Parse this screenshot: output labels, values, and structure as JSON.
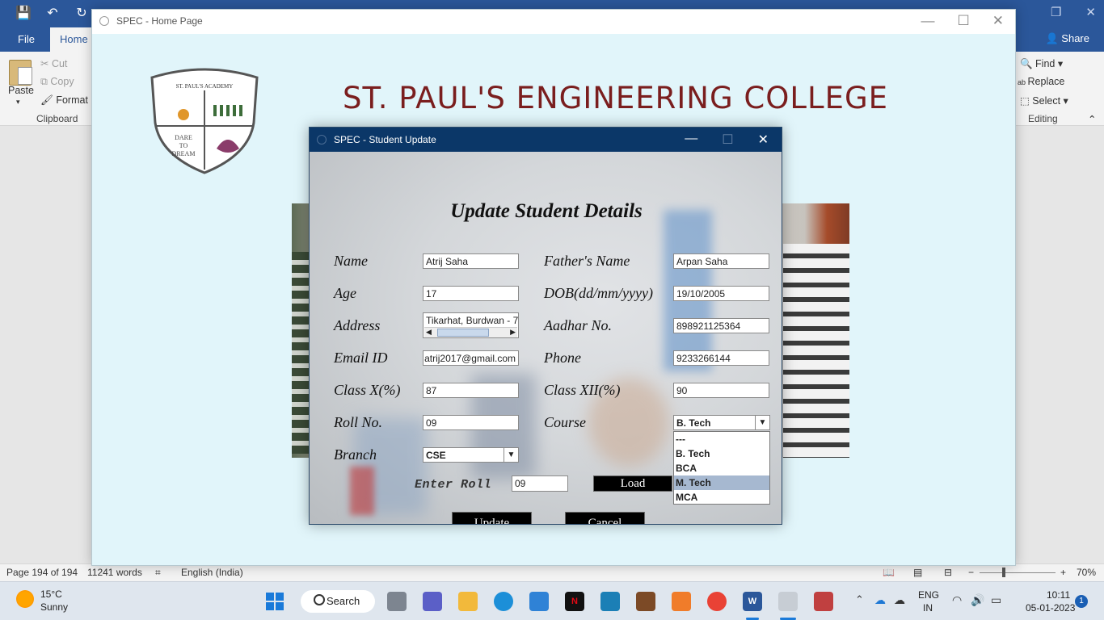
{
  "word": {
    "quick_access": [
      "💾",
      "↶",
      "↻"
    ],
    "tabs": {
      "file": "File",
      "home": "Home"
    },
    "share": "Share",
    "ribbon": {
      "paste": "Paste",
      "cut": "Cut",
      "copy": "Copy",
      "format_painter": "Format P",
      "clipboard_group": "Clipboard",
      "find": "Find",
      "replace": "Replace",
      "select": "Select",
      "editing_group": "Editing"
    },
    "status": {
      "page": "Page 194 of 194",
      "words": "11241 words",
      "language": "English (India)",
      "zoom": "70%"
    }
  },
  "home_window": {
    "title": "SPEC - Home Page",
    "college_name": "ST. PAUL'S ENGINEERING COLLEGE",
    "logo_text": [
      "ST. PAUL'S ACADEMY",
      "DARE",
      "TO",
      "DREAM"
    ]
  },
  "dialog": {
    "title": "SPEC - Student Update",
    "heading": "Update Student Details",
    "labels": {
      "name": "Name",
      "father_name": "Father's Name",
      "age": "Age",
      "dob": "DOB(dd/mm/yyyy)",
      "address": "Address",
      "aadhar": "Aadhar No.",
      "email": "Email ID",
      "phone": "Phone",
      "class_x": "Class X(%)",
      "class_xii": "Class XII(%)",
      "roll": "Roll No.",
      "course": "Course",
      "branch": "Branch",
      "enter_roll": "Enter Roll"
    },
    "values": {
      "name": "Atrij Saha",
      "father_name": "Arpan Saha",
      "age": "17",
      "dob": "19/10/2005",
      "address": "Tikarhat, Burdwan - 7",
      "aadhar": "898921125364",
      "email": "atrij2017@gmail.com",
      "phone": "9233266144",
      "class_x": "87",
      "class_xii": "90",
      "roll": "09",
      "course": "B. Tech",
      "branch": "CSE",
      "enter_roll": "09"
    },
    "course_options": [
      "---",
      "B. Tech",
      "BCA",
      "M. Tech",
      "MCA"
    ],
    "course_highlighted": "M. Tech",
    "buttons": {
      "load": "Load",
      "update": "Update",
      "cancel": "Cancel"
    }
  },
  "taskbar": {
    "weather_temp": "15°C",
    "weather_desc": "Sunny",
    "search": "Search",
    "lang_line1": "ENG",
    "lang_line2": "IN",
    "time": "10:11",
    "date": "05-01-2023",
    "notification_count": "1"
  },
  "colors": {
    "word_blue": "#2b579a",
    "dialog_titlebar": "#0b3768",
    "college_name": "#7a1e1e",
    "home_bg": "#e1f5fa"
  }
}
